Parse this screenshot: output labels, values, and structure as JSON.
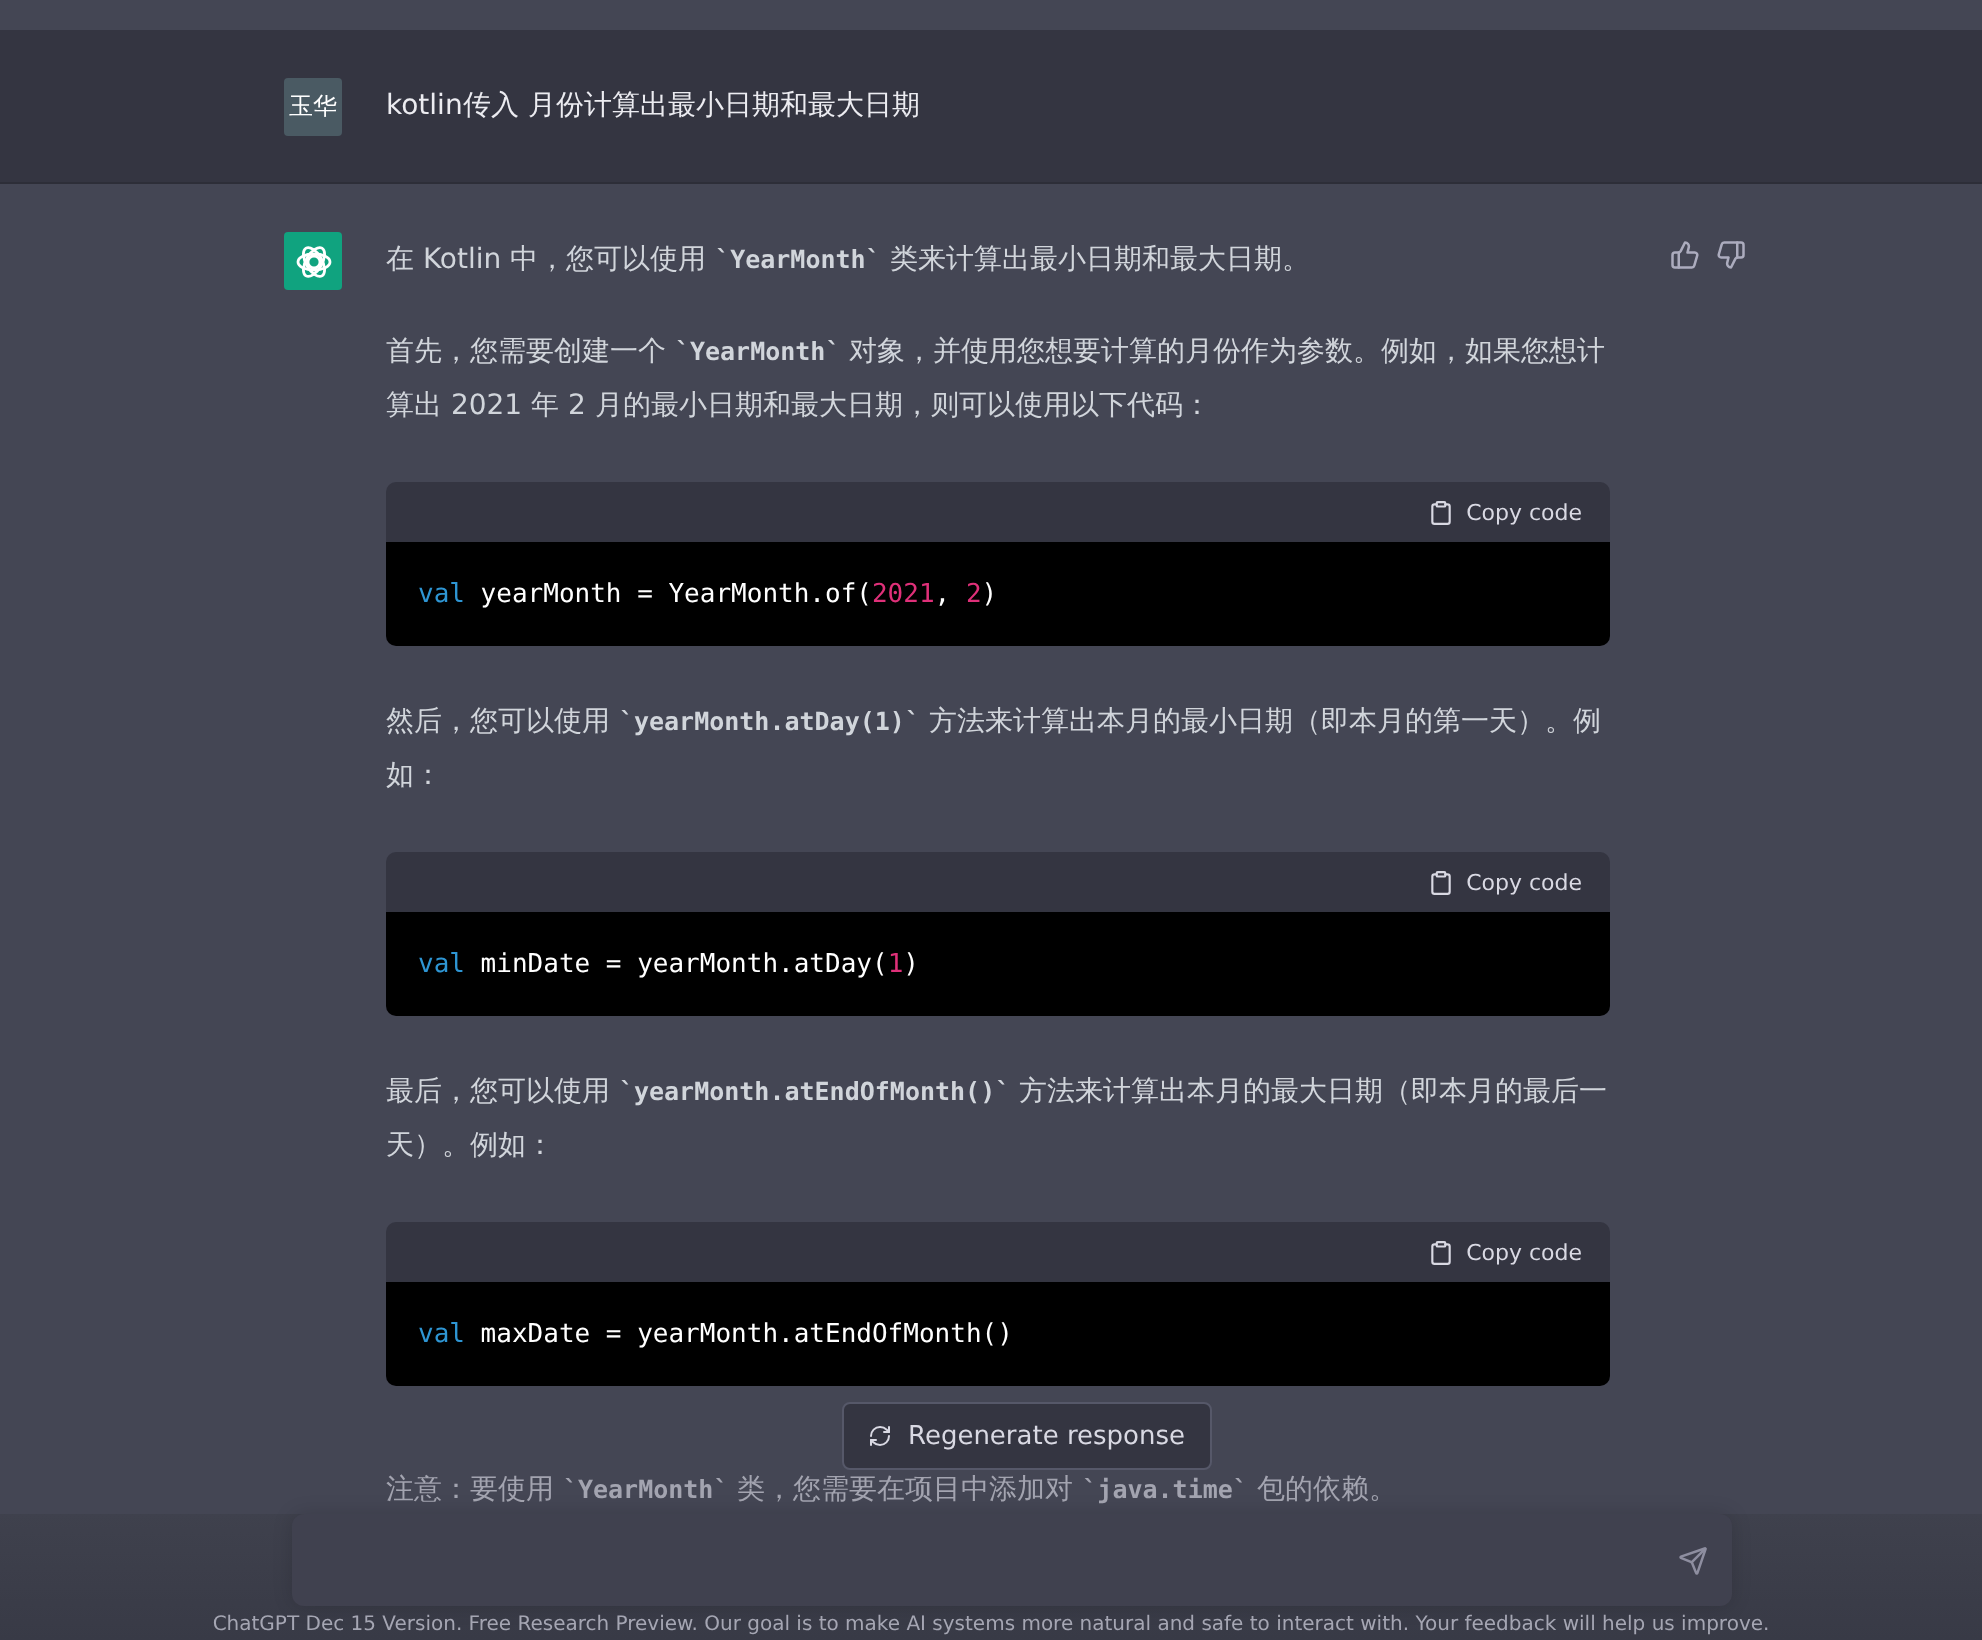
{
  "user_message": {
    "avatar": "玉华",
    "text": "kotlin传入 月份计算出最小日期和最大日期"
  },
  "assistant_message": {
    "blocks": [
      {
        "kind": "paragraph",
        "segments": [
          {
            "kind": "text",
            "text": "在 Kotlin 中，您可以使用 "
          },
          {
            "kind": "code",
            "text": "`YearMonth`"
          },
          {
            "kind": "text",
            "text": " 类来计算出最小日期和最大日期。"
          }
        ]
      },
      {
        "kind": "paragraph",
        "segments": [
          {
            "kind": "text",
            "text": "首先，您需要创建一个 "
          },
          {
            "kind": "code",
            "text": "`YearMonth`"
          },
          {
            "kind": "text",
            "text": " 对象，并使用您想要计算的月份作为参数。例如，如果您想计算出 2021 年 2 月的最小日期和最大日期，则可以使用以下代码："
          }
        ]
      },
      {
        "kind": "code_block",
        "copy_label": "Copy code",
        "tokens": [
          {
            "kind": "keyword",
            "text": "val"
          },
          {
            "kind": "plain",
            "text": " yearMonth = YearMonth.of("
          },
          {
            "kind": "number",
            "text": "2021"
          },
          {
            "kind": "plain",
            "text": ", "
          },
          {
            "kind": "number",
            "text": "2"
          },
          {
            "kind": "plain",
            "text": ")"
          }
        ]
      },
      {
        "kind": "paragraph",
        "segments": [
          {
            "kind": "text",
            "text": "然后，您可以使用 "
          },
          {
            "kind": "code",
            "text": "`yearMonth.atDay(1)`"
          },
          {
            "kind": "text",
            "text": " 方法来计算出本月的最小日期（即本月的第一天）。例如："
          }
        ]
      },
      {
        "kind": "code_block",
        "copy_label": "Copy code",
        "tokens": [
          {
            "kind": "keyword",
            "text": "val"
          },
          {
            "kind": "plain",
            "text": " minDate = yearMonth.atDay("
          },
          {
            "kind": "number",
            "text": "1"
          },
          {
            "kind": "plain",
            "text": ")"
          }
        ]
      },
      {
        "kind": "paragraph",
        "segments": [
          {
            "kind": "text",
            "text": "最后，您可以使用 "
          },
          {
            "kind": "code",
            "text": "`yearMonth.atEndOfMonth()`"
          },
          {
            "kind": "text",
            "text": " 方法来计算出本月的最大日期（即本月的最后一天）。例如："
          }
        ]
      },
      {
        "kind": "code_block",
        "copy_label": "Copy code",
        "tokens": [
          {
            "kind": "keyword",
            "text": "val"
          },
          {
            "kind": "plain",
            "text": " maxDate = yearMonth.atEndOfMonth()"
          }
        ]
      },
      {
        "kind": "faded_paragraph",
        "segments": [
          {
            "kind": "text",
            "text": "注意：要使用 "
          },
          {
            "kind": "code",
            "text": "`YearMonth`"
          },
          {
            "kind": "text",
            "text": " 类，您需要在项目中添加对 "
          },
          {
            "kind": "code",
            "text": "`java.time`"
          },
          {
            "kind": "text",
            "text": " 包的依赖。"
          }
        ]
      }
    ]
  },
  "regenerate_button": {
    "label": "Regenerate response"
  },
  "footer": {
    "text": "ChatGPT Dec 15 Version. Free Research Preview. Our goal is to make AI systems more natural and safe to interact with. Your feedback will help us improve."
  }
}
